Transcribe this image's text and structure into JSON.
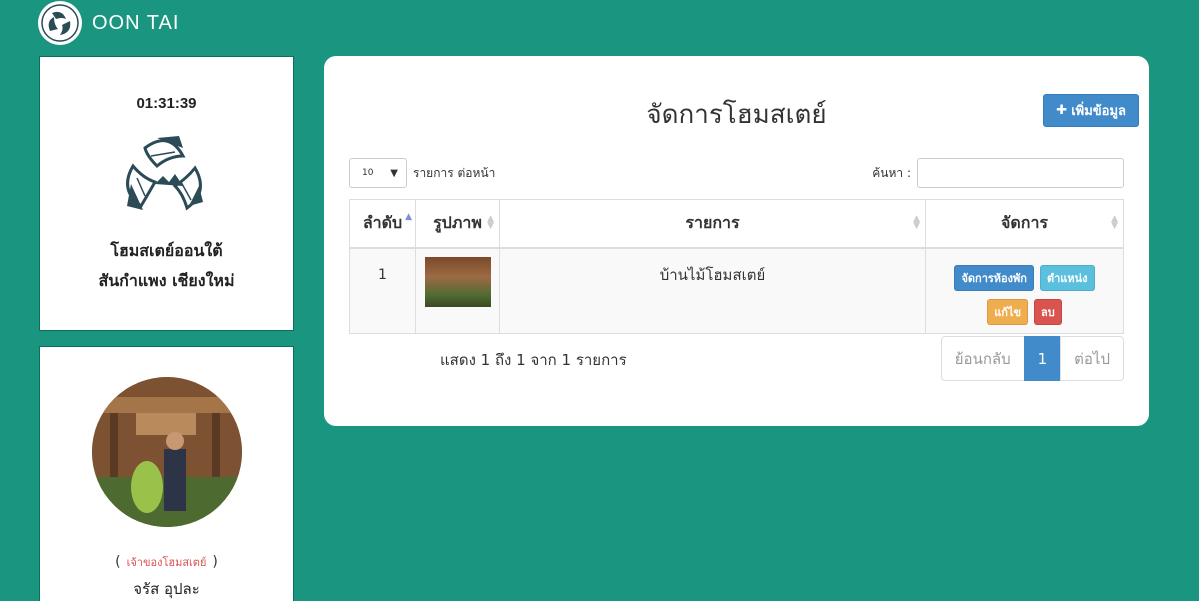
{
  "header": {
    "brand": "OON TAI"
  },
  "sidebar": {
    "clock": "01:31:39",
    "home_name_line1": "โฮมสเตย์ออนใต้",
    "home_name_line2": "สันกำแพง เชียงใหม่",
    "owner_role": "เจ้าของโฮมสเตย์",
    "owner_name": "จรัส อุปละ"
  },
  "main": {
    "title": "จัดการโฮมสเตย์",
    "add_button": "เพิ่มข้อมูล",
    "length": {
      "value": "10",
      "label": "รายการ ต่อหน้า"
    },
    "search": {
      "label": "ค้นหา :",
      "value": ""
    },
    "columns": [
      "ลำดับ",
      "รูปภาพ",
      "รายการ",
      "จัดการ"
    ],
    "rows": [
      {
        "num": "1",
        "name": "บ้านไม้โฮมสเตย์",
        "actions": [
          "จัดการห้องพัก",
          "ตำแหน่ง",
          "แก้ไข",
          "ลบ"
        ]
      }
    ],
    "info": "แสดง 1 ถึง 1 จาก 1 รายการ",
    "pagination": {
      "prev": "ย้อนกลับ",
      "current": "1",
      "next": "ต่อไป"
    }
  },
  "colors": {
    "background": "#1a9580",
    "primary": "#428bca",
    "info": "#5bc0de",
    "warning": "#f0ad4e",
    "danger": "#d9534f"
  }
}
